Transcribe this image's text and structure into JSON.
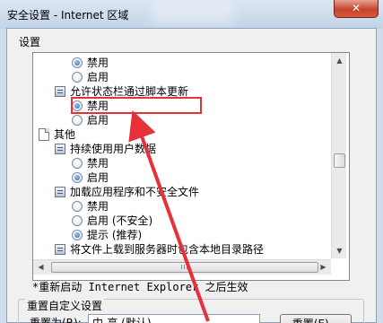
{
  "window": {
    "title": "安全设置 - Internet 区域",
    "close_glyph": "✕"
  },
  "settings_group": {
    "label": "设置"
  },
  "tree": [
    {
      "kind": "radio",
      "label": "禁用",
      "checked": true
    },
    {
      "kind": "radio",
      "label": "启用",
      "checked": false
    },
    {
      "kind": "setting",
      "label": "允许状态栏通过脚本更新"
    },
    {
      "kind": "radio",
      "label": "禁用",
      "checked": true
    },
    {
      "kind": "radio",
      "label": "启用",
      "checked": false
    },
    {
      "kind": "category",
      "label": "其他"
    },
    {
      "kind": "setting",
      "label": "持续使用用户数据"
    },
    {
      "kind": "radio",
      "label": "禁用",
      "checked": false
    },
    {
      "kind": "radio",
      "label": "启用",
      "checked": true
    },
    {
      "kind": "setting",
      "label": "加载应用程序和不安全文件"
    },
    {
      "kind": "radio",
      "label": "禁用",
      "checked": false
    },
    {
      "kind": "radio",
      "label": "启用 (不安全)",
      "checked": false
    },
    {
      "kind": "radio",
      "label": "提示 (推荐)",
      "checked": true
    },
    {
      "kind": "setting",
      "label": "将文件上载到服务器时包含本地目录路径"
    }
  ],
  "scrollbars": {
    "up_glyph": "▲",
    "down_glyph": "▼",
    "left_glyph": "◀",
    "right_glyph": "▶",
    "grip_glyph": "III"
  },
  "note": "*重新启动 Internet Explorer 之后生效",
  "reset": {
    "group_label": "重置自定义设置",
    "for_label": "重置为(R):",
    "level_value": "中-高 (默认)",
    "button_label": "重置(E)..."
  },
  "annotation": {
    "highlight_color": "#e8303a"
  }
}
